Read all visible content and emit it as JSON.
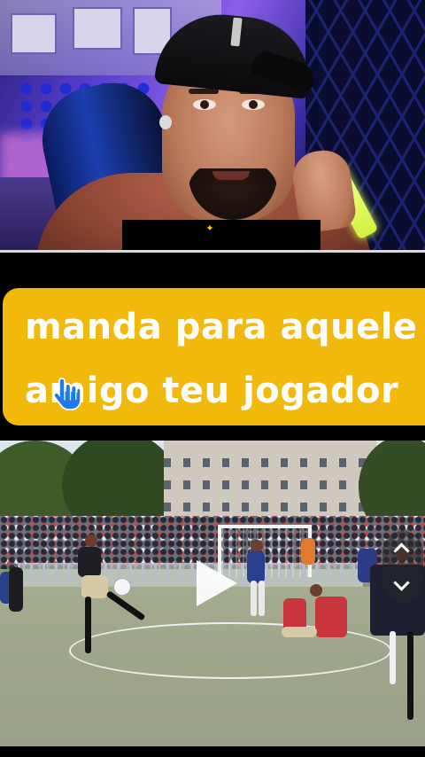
{
  "caption": {
    "line1": "manda para aquele",
    "line2": "amigo teu jogador",
    "background_color": "#f2b90d",
    "text_color": "#ffffff"
  },
  "icons": {
    "cursor": "hand-pointer-icon",
    "play": "play-icon",
    "scroll_up": "chevron-up-icon",
    "scroll_down": "chevron-down-icon",
    "webcam_tab_icon": "money-emoji-icon"
  },
  "video": {
    "state": "paused"
  }
}
